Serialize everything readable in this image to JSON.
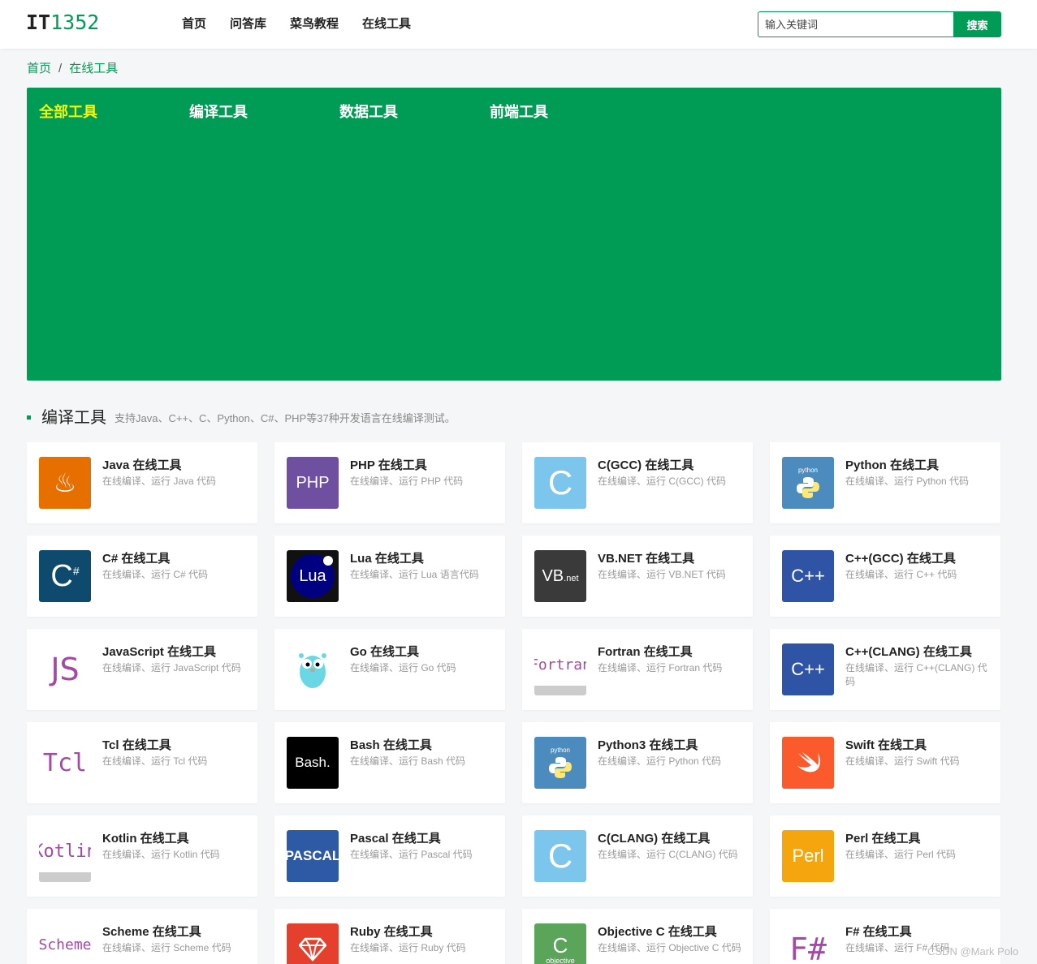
{
  "header": {
    "logo_it": "IT",
    "logo_num": "1352",
    "nav": [
      "首页",
      "问答库",
      "菜鸟教程",
      "在线工具"
    ],
    "search_placeholder": "输入关键词",
    "search_button": "搜索"
  },
  "breadcrumb": {
    "home": "首页",
    "sep": "/",
    "current": "在线工具"
  },
  "hero": {
    "tabs": [
      "全部工具",
      "编译工具",
      "数据工具",
      "前端工具"
    ],
    "active_tab": "全部工具"
  },
  "section": {
    "title": "编译工具",
    "desc": "支持Java、C++、C、Python、C#、PHP等37种开发语言在线编译测试。"
  },
  "tools": [
    {
      "title": "Java 在线工具",
      "desc": "在线编译、运行 Java 代码",
      "icon": "java-icon",
      "icon_text": "♨",
      "bg": "#e76f00"
    },
    {
      "title": "PHP 在线工具",
      "desc": "在线编译、运行 PHP 代码",
      "icon": "php-icon",
      "icon_text": "PHP",
      "bg": "#6f4fa0"
    },
    {
      "title": "C(GCC) 在线工具",
      "desc": "在线编译、运行 C(GCC) 代码",
      "icon": "c-icon",
      "icon_text": "C",
      "bg": "#7cc6ee"
    },
    {
      "title": "Python 在线工具",
      "desc": "在线编译、运行 Python 代码",
      "icon": "python-icon",
      "icon_text": "python",
      "bg": "#4b8bbe"
    },
    {
      "title": "C# 在线工具",
      "desc": "在线编译、运行 C# 代码",
      "icon": "csharp-icon",
      "icon_text": "C#",
      "bg": "#0e4a6e"
    },
    {
      "title": "Lua 在线工具",
      "desc": "在线编译、运行 Lua 语言代码",
      "icon": "lua-icon",
      "icon_text": "Lua",
      "bg": "#111111"
    },
    {
      "title": "VB.NET 在线工具",
      "desc": "在线编译、运行 VB.NET 代码",
      "icon": "vbnet-icon",
      "icon_text": "VB.net",
      "bg": "#3a3a3a"
    },
    {
      "title": "C++(GCC) 在线工具",
      "desc": "在线编译、运行 C++ 代码",
      "icon": "cpp-icon",
      "icon_text": "C++",
      "bg": "#2f54a6"
    },
    {
      "title": "JavaScript 在线工具",
      "desc": "在线编译、运行 JavaScript 代码",
      "icon": "javascript-icon",
      "icon_text": "JS",
      "bg": "#ffffff"
    },
    {
      "title": "Go 在线工具",
      "desc": "在线编译、运行 Go 代码",
      "icon": "go-gopher-icon",
      "icon_text": "",
      "bg": "#ffffff"
    },
    {
      "title": "Fortran 在线工具",
      "desc": "在线编译、运行 Fortran 代码",
      "icon": "fortran-icon",
      "icon_text": "Fortran",
      "bg": "#ffffff"
    },
    {
      "title": "C++(CLANG) 在线工具",
      "desc": "在线编译、运行 C++(CLANG) 代码",
      "icon": "cpp-clang-icon",
      "icon_text": "C++",
      "bg": "#2f54a6"
    },
    {
      "title": "Tcl 在线工具",
      "desc": "在线编译、运行 Tcl 代码",
      "icon": "tcl-icon",
      "icon_text": "Tcl",
      "bg": "#ffffff"
    },
    {
      "title": "Bash 在线工具",
      "desc": "在线编译、运行 Bash 代码",
      "icon": "bash-icon",
      "icon_text": "Bash.",
      "bg": "#000000"
    },
    {
      "title": "Python3 在线工具",
      "desc": "在线编译、运行 Python 代码",
      "icon": "python3-icon",
      "icon_text": "python",
      "bg": "#4b8bbe"
    },
    {
      "title": "Swift 在线工具",
      "desc": "在线编译、运行 Swift 代码",
      "icon": "swift-icon",
      "icon_text": "",
      "bg": "#fa5a2c"
    },
    {
      "title": "Kotlin 在线工具",
      "desc": "在线编译、运行 Kotlin 代码",
      "icon": "kotlin-icon",
      "icon_text": "Kotlin",
      "bg": "#ffffff"
    },
    {
      "title": "Pascal 在线工具",
      "desc": "在线编译、运行 Pascal 代码",
      "icon": "pascal-icon",
      "icon_text": "PASCAL",
      "bg": "#2e5aa5"
    },
    {
      "title": "C(CLANG) 在线工具",
      "desc": "在线编译、运行 C(CLANG) 代码",
      "icon": "c-clang-icon",
      "icon_text": "C",
      "bg": "#7cc6ee"
    },
    {
      "title": "Perl 在线工具",
      "desc": "在线编译、运行 Perl 代码",
      "icon": "perl-icon",
      "icon_text": "Perl",
      "bg": "#f5a60f"
    },
    {
      "title": "Scheme 在线工具",
      "desc": "在线编译、运行 Scheme 代码",
      "icon": "scheme-icon",
      "icon_text": "Scheme",
      "bg": "#ffffff"
    },
    {
      "title": "Ruby 在线工具",
      "desc": "在线编译、运行 Ruby 代码",
      "icon": "ruby-icon",
      "icon_text": "",
      "bg": "#e5402e"
    },
    {
      "title": "Objective C 在线工具",
      "desc": "在线编译、运行 Objective C 代码",
      "icon": "objective-c-icon",
      "icon_text": "C",
      "bg": "#5aa55a"
    },
    {
      "title": "F# 在线工具",
      "desc": "在线编译、运行 F# 代码",
      "icon": "fsharp-icon",
      "icon_text": "F#",
      "bg": "#ffffff"
    }
  ],
  "watermark": "CSDN @Mark Polo"
}
